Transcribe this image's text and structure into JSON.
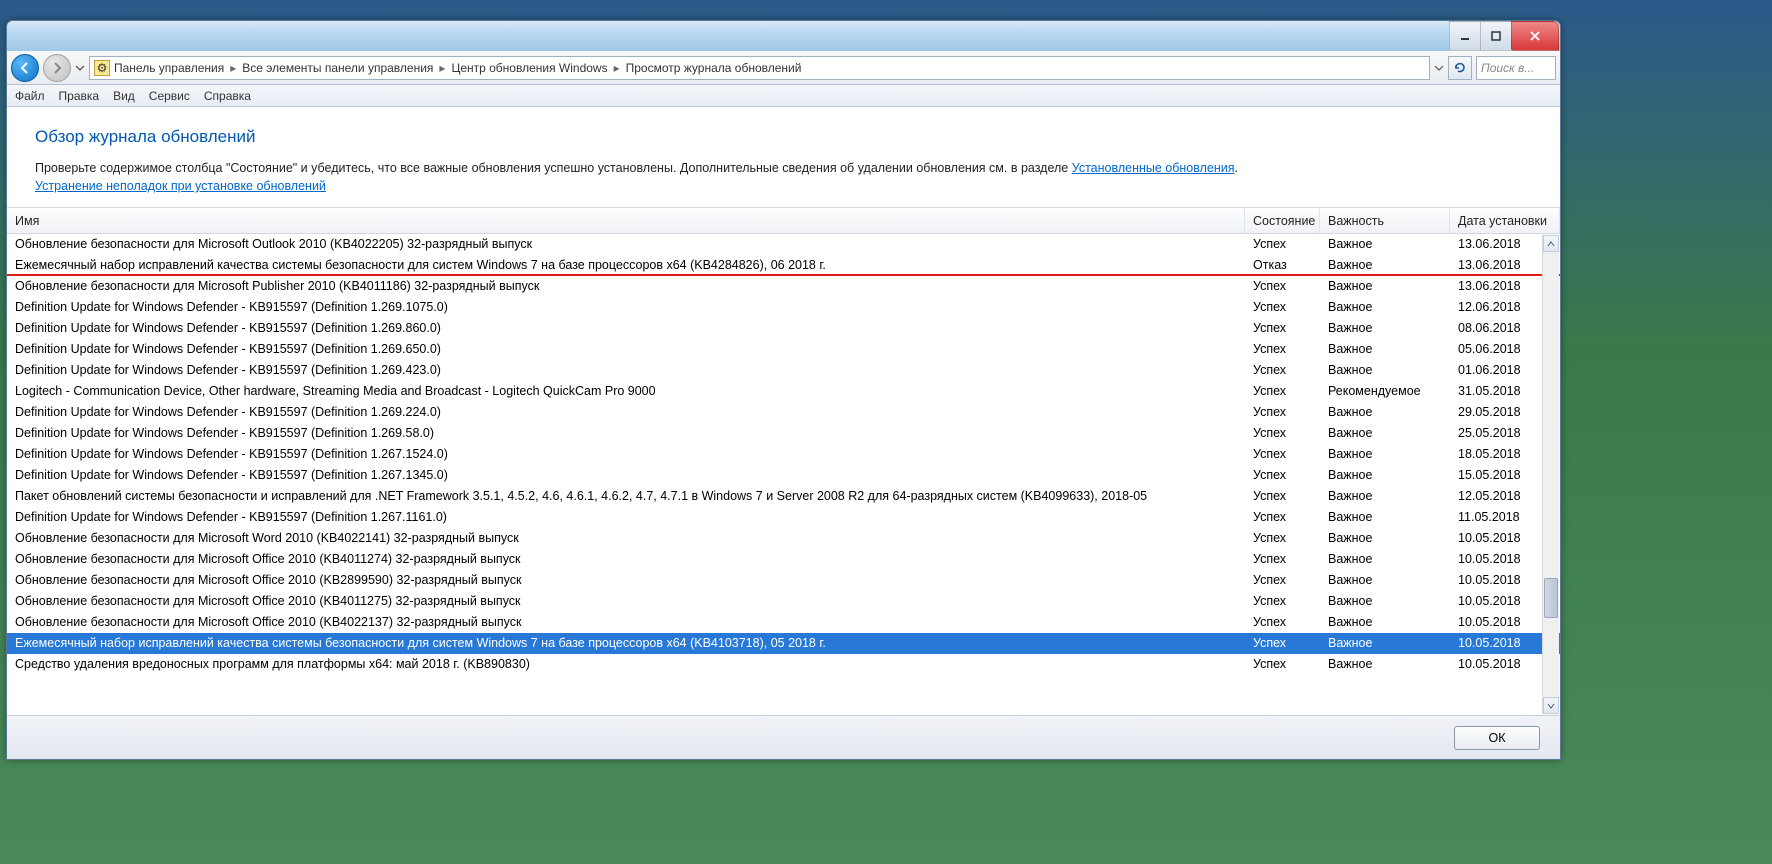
{
  "breadcrumb": {
    "items": [
      "Панель управления",
      "Все элементы панели управления",
      "Центр обновления Windows",
      "Просмотр журнала обновлений"
    ]
  },
  "search_placeholder": "Поиск в...",
  "menu": {
    "file": "Файл",
    "edit": "Правка",
    "view": "Вид",
    "tools": "Сервис",
    "help": "Справка"
  },
  "page": {
    "title": "Обзор журнала обновлений",
    "subtitle_pre": "Проверьте содержимое столбца \"Состояние\" и убедитесь, что все важные обновления успешно установлены. Дополнительные сведения об удалении обновления см. в разделе ",
    "subtitle_link": "Установленные обновления",
    "troubleshoot_link": "Устранение неполадок при установке обновлений"
  },
  "columns": {
    "name": "Имя",
    "state": "Состояние",
    "importance": "Важность",
    "date": "Дата установки"
  },
  "ok_label": "ОК",
  "rows": [
    {
      "name": "Обновление безопасности для Microsoft Outlook 2010 (KB4022205) 32-разрядный выпуск",
      "state": "Успех",
      "imp": "Важное",
      "date": "13.06.2018"
    },
    {
      "name": "Ежемесячный набор исправлений качества системы безопасности для систем Windows 7 на базе процессоров x64 (KB4284826), 06 2018 г.",
      "state": "Отказ",
      "imp": "Важное",
      "date": "13.06.2018",
      "underlined": true
    },
    {
      "name": "Обновление безопасности для Microsoft Publisher 2010 (KB4011186) 32-разрядный выпуск",
      "state": "Успех",
      "imp": "Важное",
      "date": "13.06.2018"
    },
    {
      "name": "Definition Update for Windows Defender - KB915597 (Definition 1.269.1075.0)",
      "state": "Успех",
      "imp": "Важное",
      "date": "12.06.2018"
    },
    {
      "name": "Definition Update for Windows Defender - KB915597 (Definition 1.269.860.0)",
      "state": "Успех",
      "imp": "Важное",
      "date": "08.06.2018"
    },
    {
      "name": "Definition Update for Windows Defender - KB915597 (Definition 1.269.650.0)",
      "state": "Успех",
      "imp": "Важное",
      "date": "05.06.2018"
    },
    {
      "name": "Definition Update for Windows Defender - KB915597 (Definition 1.269.423.0)",
      "state": "Успех",
      "imp": "Важное",
      "date": "01.06.2018"
    },
    {
      "name": "Logitech - Communication Device, Other hardware, Streaming Media and Broadcast - Logitech QuickCam Pro 9000",
      "state": "Успех",
      "imp": "Рекомендуемое",
      "date": "31.05.2018"
    },
    {
      "name": "Definition Update for Windows Defender - KB915597 (Definition 1.269.224.0)",
      "state": "Успех",
      "imp": "Важное",
      "date": "29.05.2018"
    },
    {
      "name": "Definition Update for Windows Defender - KB915597 (Definition 1.269.58.0)",
      "state": "Успех",
      "imp": "Важное",
      "date": "25.05.2018"
    },
    {
      "name": "Definition Update for Windows Defender - KB915597 (Definition 1.267.1524.0)",
      "state": "Успех",
      "imp": "Важное",
      "date": "18.05.2018"
    },
    {
      "name": "Definition Update for Windows Defender - KB915597 (Definition 1.267.1345.0)",
      "state": "Успех",
      "imp": "Важное",
      "date": "15.05.2018"
    },
    {
      "name": "Пакет обновлений системы безопасности и исправлений для .NET Framework 3.5.1, 4.5.2, 4.6, 4.6.1, 4.6.2, 4.7, 4.7.1 в Windows 7 и Server 2008 R2 для 64-разрядных систем (KB4099633), 2018-05",
      "state": "Успех",
      "imp": "Важное",
      "date": "12.05.2018"
    },
    {
      "name": "Definition Update for Windows Defender - KB915597 (Definition 1.267.1161.0)",
      "state": "Успех",
      "imp": "Важное",
      "date": "11.05.2018"
    },
    {
      "name": "Обновление безопасности для Microsoft Word 2010 (KB4022141) 32-разрядный выпуск",
      "state": "Успех",
      "imp": "Важное",
      "date": "10.05.2018"
    },
    {
      "name": "Обновление безопасности для Microsoft Office 2010 (KB4011274) 32-разрядный выпуск",
      "state": "Успех",
      "imp": "Важное",
      "date": "10.05.2018"
    },
    {
      "name": "Обновление безопасности для Microsoft Office 2010 (KB2899590) 32-разрядный выпуск",
      "state": "Успех",
      "imp": "Важное",
      "date": "10.05.2018"
    },
    {
      "name": "Обновление безопасности для Microsoft Office 2010 (KB4011275) 32-разрядный выпуск",
      "state": "Успех",
      "imp": "Важное",
      "date": "10.05.2018"
    },
    {
      "name": "Обновление безопасности для Microsoft Office 2010 (KB4022137) 32-разрядный выпуск",
      "state": "Успех",
      "imp": "Важное",
      "date": "10.05.2018"
    },
    {
      "name": "Ежемесячный набор исправлений качества системы безопасности для систем Windows 7 на базе процессоров x64 (KB4103718), 05 2018 г.",
      "state": "Успех",
      "imp": "Важное",
      "date": "10.05.2018",
      "selected": true
    },
    {
      "name": "Средство удаления вредоносных программ для платформы x64: май 2018 г. (KB890830)",
      "state": "Успех",
      "imp": "Важное",
      "date": "10.05.2018"
    }
  ]
}
